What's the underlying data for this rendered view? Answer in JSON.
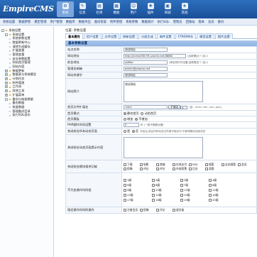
{
  "app": {
    "logo_main": "EmpireCMS",
    "logo_sub": "EmpireCMS"
  },
  "topnav": [
    {
      "label": "系统",
      "icon": "system-icon",
      "active": true
    },
    {
      "label": "信息",
      "icon": "info-icon"
    },
    {
      "label": "栏目",
      "icon": "column-icon"
    },
    {
      "label": "模板",
      "icon": "template-icon"
    },
    {
      "label": "用户",
      "icon": "user-icon"
    },
    {
      "label": "插件",
      "icon": "plugin-icon"
    },
    {
      "label": "商城",
      "icon": "shop-icon"
    },
    {
      "label": "其他",
      "icon": "other-icon"
    }
  ],
  "subnav": [
    "系统设置",
    "数据更新",
    "模型管理",
    "用户管理",
    "数据库",
    "数据导出",
    "备份恢复",
    "附件管理",
    "系统参数",
    "数据统计",
    "执行SQL",
    "管理员",
    "回收站",
    "版本",
    "会员",
    "备份"
  ],
  "sidebar": [
    {
      "label": "系统设置",
      "level": 0,
      "type": "folder",
      "exp": "-"
    },
    {
      "label": "系统设置",
      "level": 1,
      "type": "folder",
      "exp": "-"
    },
    {
      "label": "系统参数设置",
      "level": 2,
      "type": "doc"
    },
    {
      "label": "数据更新中心",
      "level": 2,
      "type": "doc"
    },
    {
      "label": "清除生成缓存",
      "level": 2,
      "type": "doc"
    },
    {
      "label": "扩展变量",
      "level": 2,
      "type": "doc"
    },
    {
      "label": "管理变量",
      "level": 2,
      "type": "doc"
    },
    {
      "label": "安全参数配置",
      "level": 2,
      "type": "doc"
    },
    {
      "label": "网站首页管理",
      "level": 2,
      "type": "doc"
    },
    {
      "label": "网站内容",
      "level": 2,
      "type": "doc"
    },
    {
      "label": "数据更新",
      "level": 1,
      "type": "folder",
      "exp": "+"
    },
    {
      "label": "数据表与系统模型",
      "level": 1,
      "type": "folder",
      "exp": "+"
    },
    {
      "label": "计划任务",
      "level": 1,
      "type": "folder",
      "exp": "+"
    },
    {
      "label": "附件管理",
      "level": 1,
      "type": "folder",
      "exp": "+"
    },
    {
      "label": "工作流",
      "level": 1,
      "type": "folder",
      "exp": "+"
    },
    {
      "label": "其他工具",
      "level": 1,
      "type": "folder",
      "exp": "+"
    },
    {
      "label": "扩展菜单",
      "level": 1,
      "type": "folder",
      "exp": "+"
    },
    {
      "label": "备份与恢复数据",
      "level": 1,
      "type": "folder",
      "exp": "-"
    },
    {
      "label": "备份数据",
      "level": 2,
      "type": "doc"
    },
    {
      "label": "恢复数据",
      "level": 2,
      "type": "doc"
    },
    {
      "label": "管理备份目录",
      "level": 2,
      "type": "doc"
    },
    {
      "label": "执行SQL语句",
      "level": 2,
      "type": "doc"
    }
  ],
  "location": "位置: 参数设置",
  "tabs": [
    "基本属性",
    "用户设置",
    "文件设置",
    "刷新设置",
    "分组生成",
    "邮件设置",
    "FTP/EMAIL",
    "模型设置",
    "图片设置"
  ],
  "form": {
    "header": "基本参数设置",
    "site_name": {
      "label": "站点名称",
      "value": "测试网站"
    },
    "site_url": {
      "label": "网站地址",
      "value": "http://ecms058.99.uanme.net:8888/",
      "hint": "(结尾需加\"/\",如:/)"
    },
    "news_url": {
      "label": "前台地址",
      "value": "/d/file/",
      "hint": "(绑定附件时设置,结尾需加\"/\",如:/)"
    },
    "admin_email": {
      "label": "管理员邮箱",
      "value": "admin@phome.net"
    },
    "keywords": {
      "label": "网站关键字",
      "value": "测试网站"
    },
    "description": {
      "label": "网站简介",
      "value": "测试网站"
    },
    "index_ext": {
      "label": "首页文件扩展名",
      "value": ".html",
      "btn": "扩展名",
      "hint": "(如: .html,.htm,.xml,.php)"
    },
    "index_mode": {
      "label": "首页模式",
      "opt1": "静态首页",
      "opt2": "动态首页"
    },
    "dyn_index": {
      "label": "首页模板",
      "opt1": "增加",
      "opt2": "不增加"
    },
    "php_time": {
      "label": "PHP超时时间设置",
      "value": "0",
      "hint": "秒 (一般不需要设置)"
    },
    "close_site": {
      "label": "关闭前台所有动态页面",
      "opt1": "是",
      "opt2": "否",
      "hint": "开启后,前台所有动态文件都不能访问,不影响静态页面浏览"
    },
    "close_tip": {
      "label": "关闭前台动态页面提示内容"
    },
    "close_funcs": {
      "label": "关闭前台模块相关功能",
      "items": [
        "下载",
        "电影",
        "商城",
        "在线支付",
        "RSS",
        "搜索",
        "全站搜索",
        "会员",
        "投稿",
        "评论",
        "评分",
        "外部投票",
        "后台",
        "游客"
      ]
    },
    "member_groups": {
      "label": "不开启操作时间组",
      "items": [
        "1级",
        "2级",
        "3级",
        "4级",
        "5级",
        "6级",
        "7级",
        "8级",
        "9级",
        "10级",
        "11级",
        "12级",
        "13级",
        "14级",
        "15级",
        "16级",
        "17级",
        "18级",
        "19级",
        "20级"
      ]
    },
    "limit_action": {
      "label": "限定操作时间的操作",
      "items": [
        "注册会员",
        "投稿",
        "评论",
        "留言板"
      ]
    }
  }
}
